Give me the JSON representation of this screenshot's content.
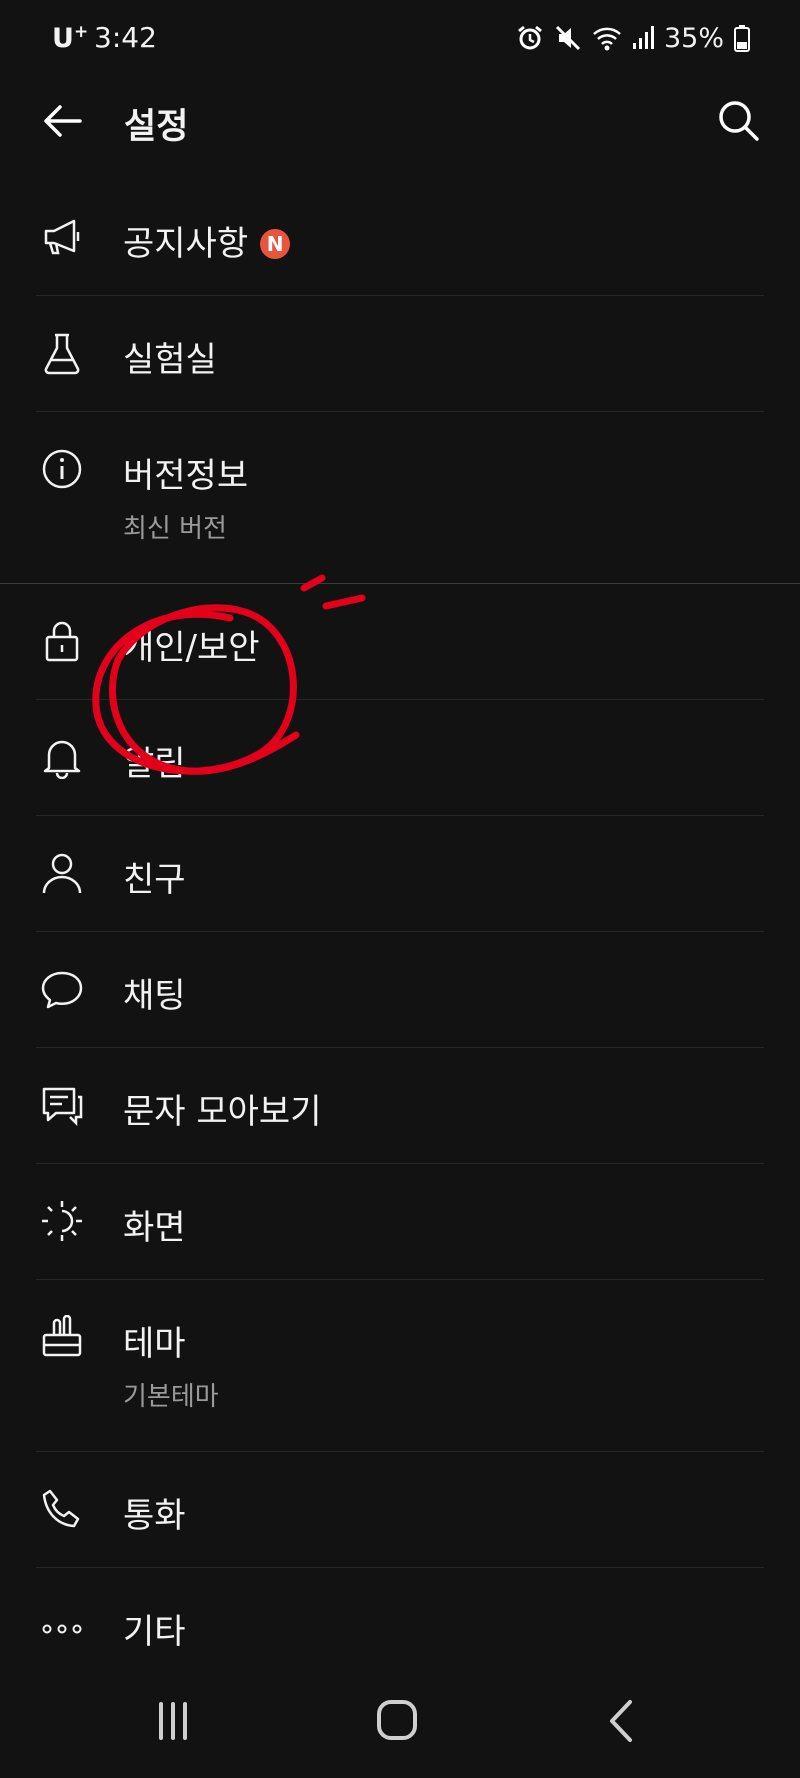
{
  "status_bar": {
    "carrier": "U",
    "carrier_sup": "+",
    "time": "3:42",
    "battery": "35%"
  },
  "header": {
    "title": "설정"
  },
  "menu": {
    "notice": {
      "label": "공지사항",
      "badge": "N"
    },
    "lab": {
      "label": "실험실"
    },
    "version": {
      "label": "버전정보",
      "sub": "최신 버전"
    },
    "privacy": {
      "label": "개인/보안"
    },
    "alarm": {
      "label": "알림"
    },
    "friends": {
      "label": "친구"
    },
    "chat": {
      "label": "채팅"
    },
    "sms": {
      "label": "문자 모아보기"
    },
    "display": {
      "label": "화면"
    },
    "theme": {
      "label": "테마",
      "sub": "기본테마"
    },
    "call": {
      "label": "통화"
    },
    "etc": {
      "label": "기타"
    }
  },
  "colors": {
    "background": "#121212",
    "badge": "#e8553d",
    "annotation": "#e3001b"
  }
}
